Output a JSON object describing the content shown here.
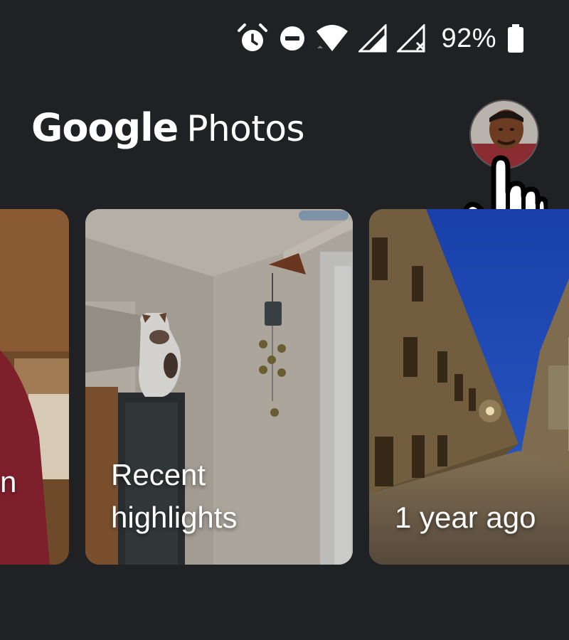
{
  "status_bar": {
    "icons": [
      "alarm-icon",
      "do-not-disturb-icon",
      "wifi-icon",
      "cell-signal-icon",
      "cell-signal-no-sim-icon",
      "battery-icon"
    ],
    "battery_percent": "92%"
  },
  "header": {
    "brand": "Google",
    "product": "Photos",
    "avatar_icon": "account-avatar"
  },
  "memories": [
    {
      "label": "n"
    },
    {
      "label_line1": "Recent",
      "label_line2": "highlights"
    },
    {
      "label": "1 year ago"
    }
  ],
  "colors": {
    "background": "#202124",
    "text": "#ffffff"
  }
}
